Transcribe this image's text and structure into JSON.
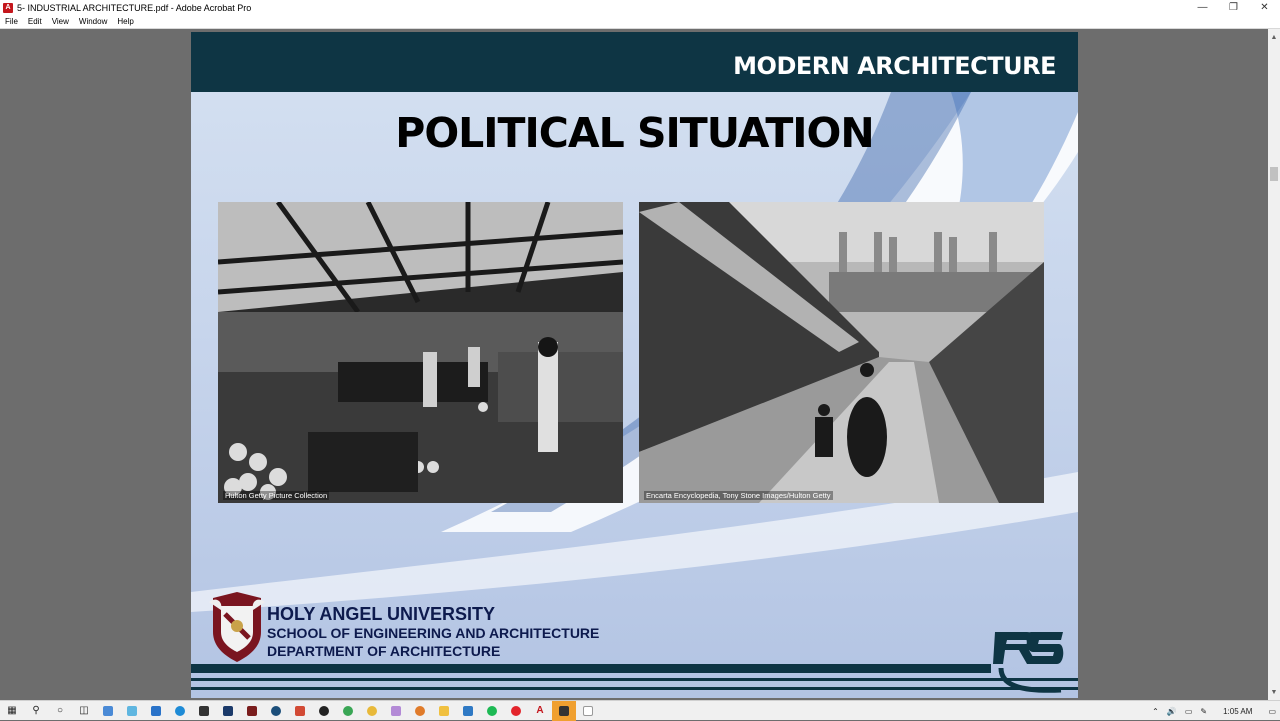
{
  "window": {
    "title": "5- INDUSTRIAL ARCHITECTURE.pdf - Adobe Acrobat Pro",
    "app_icon": "acrobat-icon",
    "controls": [
      "minimize",
      "restore",
      "close"
    ]
  },
  "menu": {
    "items": [
      "File",
      "Edit",
      "View",
      "Window",
      "Help"
    ]
  },
  "slide": {
    "header": "MODERN ARCHITECTURE",
    "title": "POLITICAL SITUATION",
    "photos": [
      {
        "credit": "Hulton Getty Picture Collection"
      },
      {
        "credit": "Encarta Encyclopedia, Tony Stone Images/Hulton Getty"
      }
    ],
    "footer": {
      "university": "HOLY ANGEL UNIVERSITY",
      "school": "SCHOOL OF ENGINEERING AND ARCHITECTURE",
      "department": "DEPARTMENT OF ARCHITECTURE"
    },
    "colors": {
      "header_bg": "#0e3544",
      "footer_text": "#0d1a4d",
      "slide_bg": "#c7d5ec"
    }
  },
  "taskbar": {
    "icons": [
      "windows-start-icon",
      "search-icon",
      "cortana-icon",
      "task-view-icon",
      "notepad-icon",
      "paint-icon",
      "photos-icon",
      "edge-icon",
      "calculator-icon",
      "terminal-icon",
      "app-icon",
      "steam-icon",
      "git-icon",
      "chrome-icon",
      "chrome-icon-2",
      "paint3d-icon",
      "search-app-icon",
      "explorer-icon",
      "remote-desktop-icon",
      "spotify-icon",
      "opera-icon",
      "acrobat-icon",
      "app-active-icon",
      "document-icon"
    ],
    "tray": {
      "time": "1:05 AM"
    }
  }
}
